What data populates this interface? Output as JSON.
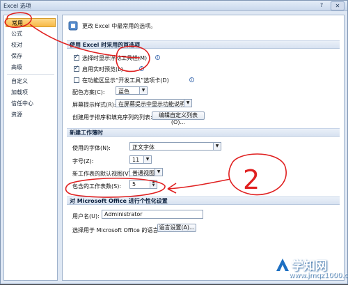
{
  "window": {
    "title": "Excel 选项",
    "help_glyph": "?",
    "close_glyph": "✕"
  },
  "sidebar": {
    "items": [
      {
        "label": "常用",
        "active": true
      },
      {
        "label": "公式"
      },
      {
        "label": "校对"
      },
      {
        "label": "保存"
      },
      {
        "label": "高级"
      },
      {
        "label": "自定义"
      },
      {
        "label": "加载项"
      },
      {
        "label": "信任中心"
      },
      {
        "label": "资源"
      }
    ]
  },
  "content": {
    "header": "更改 Excel 中最常用的选项。",
    "sections": {
      "top_options": "使用 Excel 时采用的首选项",
      "new_workbook": "新建工作簿时",
      "personalize": "对 Microsoft Office 进行个性化设置"
    },
    "top_options": {
      "show_mini_toolbar": {
        "label": "选择时显示浮动工具栏(M)",
        "checked": true
      },
      "live_preview": {
        "label": "启用实时预览(L)",
        "checked": true
      },
      "developer_tab": {
        "label": "在功能区显示“开发工具”选项卡(D)",
        "checked": false
      },
      "color_scheme": {
        "label": "配色方案(C):",
        "value": "蓝色"
      },
      "screentip_style": {
        "label": "屏幕提示样式(R):",
        "value": "在屏幕提示中显示功能说明"
      },
      "custom_lists": {
        "label": "创建用于排序和填充序列的列表:",
        "button": "编辑自定义列表(O)..."
      }
    },
    "new_workbook": {
      "font": {
        "label": "使用的字体(N):",
        "value": "正文字体"
      },
      "font_size": {
        "label": "字号(Z):",
        "value": "11"
      },
      "default_view": {
        "label": "新工作表的默认视图(V):",
        "value": "普通视图"
      },
      "sheet_count": {
        "label": "包含的工作表数(S):",
        "value": "5"
      }
    },
    "personalize": {
      "username": {
        "label": "用户名(U):",
        "value": "Administrator"
      },
      "language": {
        "label": "选择用于 Microsoft Office 的语言:",
        "button": "语言设置(A)..."
      }
    }
  },
  "annotation": {
    "number": "2",
    "color": "#e02020"
  },
  "watermark": {
    "title": "学知网",
    "url": "www.jmqz1000.com",
    "color": "#1d6fc2"
  }
}
